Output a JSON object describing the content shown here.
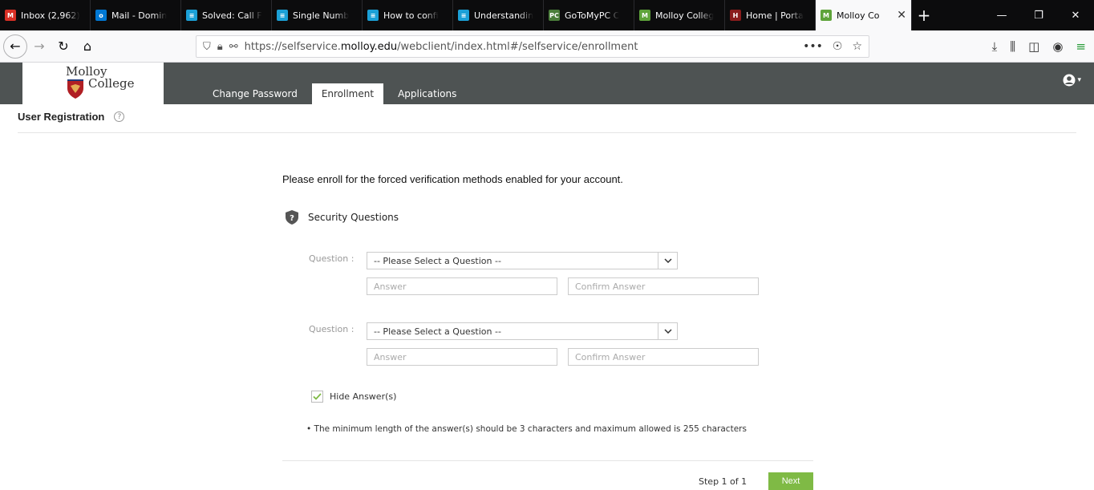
{
  "browser": {
    "tabs": [
      {
        "label": "Inbox (2,962)",
        "icon": "gmail-icon",
        "color": "#d93025",
        "glyph": "M"
      },
      {
        "label": "Mail - Domin",
        "icon": "outlook-icon",
        "color": "#0078d4",
        "glyph": "o"
      },
      {
        "label": "Solved: Call F",
        "icon": "cisco-icon",
        "color": "#1ba0d7",
        "glyph": "≡"
      },
      {
        "label": "Single Numb",
        "icon": "cisco-icon",
        "color": "#1ba0d7",
        "glyph": "≡"
      },
      {
        "label": "How to confi",
        "icon": "cisco-icon",
        "color": "#1ba0d7",
        "glyph": "≡"
      },
      {
        "label": "Understandin",
        "icon": "cisco-icon",
        "color": "#1ba0d7",
        "glyph": "≡"
      },
      {
        "label": "GoToMyPC C",
        "icon": "gotomypc-icon",
        "color": "#4a7d3a",
        "glyph": "PC"
      },
      {
        "label": "Molloy Colleg",
        "icon": "molloy-icon",
        "color": "#5ea33a",
        "glyph": "M"
      },
      {
        "label": "Home | Porta",
        "icon": "portal-icon",
        "color": "#8a1c1c",
        "glyph": "H"
      }
    ],
    "active_tab": {
      "label": "Molloy Co",
      "icon": "molloy-icon",
      "color": "#5ea33a",
      "glyph": "M"
    },
    "url_prefix": "https://selfservice.",
    "url_domain": "molloy.edu",
    "url_suffix": "/webclient/index.html#/selfservice/enrollment"
  },
  "app": {
    "logo_line1": "Molloy",
    "logo_line2": "College",
    "tabs": [
      "Change Password",
      "Enrollment",
      "Applications"
    ],
    "active_tab_index": 1,
    "page_title": "User Registration",
    "instruction": "Please enroll for the forced verification methods enabled for your account.",
    "section_title": "Security Questions",
    "question_label": "Question :",
    "question_placeholder": "-- Please Select a Question --",
    "answer_placeholder": "Answer",
    "confirm_placeholder": "Confirm Answer",
    "hide_answers_label": "Hide Answer(s)",
    "hide_answers_checked": true,
    "note": "• The minimum length of the answer(s) should be 3 characters and maximum allowed is 255 characters",
    "step_label": "Step 1 of 1",
    "next_label": "Next",
    "accent_color": "#7fba45",
    "header_color": "#4e5353"
  }
}
